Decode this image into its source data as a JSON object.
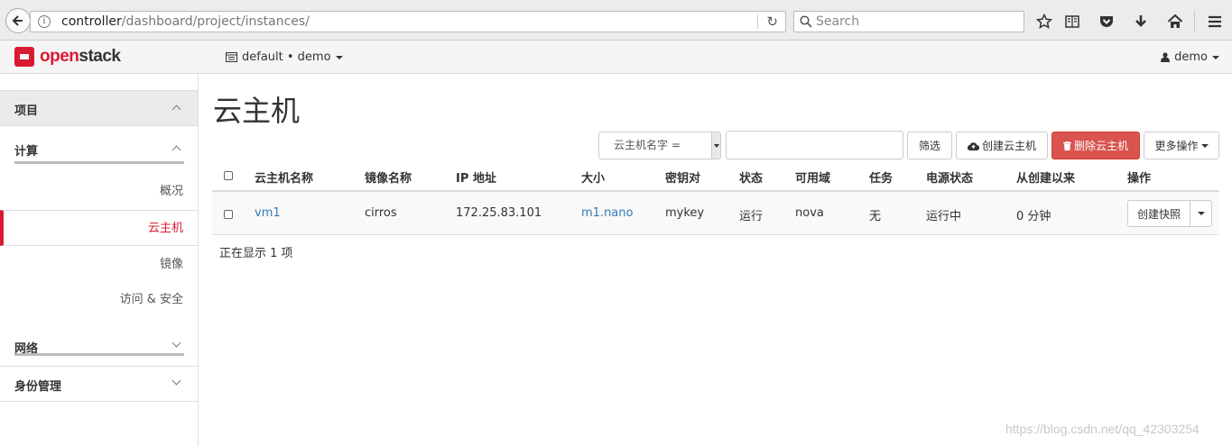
{
  "browser": {
    "url_host": "controller",
    "url_path": "/dashboard/project/instances/",
    "search_placeholder": "Search"
  },
  "topnav": {
    "logo_open": "open",
    "logo_stack": "stack",
    "project_selector": "default • demo",
    "user": "demo"
  },
  "sidebar": {
    "project_label": "项目",
    "compute_label": "计算",
    "items": [
      {
        "label": "概况"
      },
      {
        "label": "云主机",
        "active": true
      },
      {
        "label": "镜像"
      },
      {
        "label": "访问 & 安全"
      }
    ],
    "network_label": "网络",
    "identity_label": "身份管理"
  },
  "main": {
    "title": "云主机",
    "filter_field": "云主机名字 =",
    "filter_value": "",
    "buttons": {
      "filter": "筛选",
      "create": "创建云主机",
      "delete": "删除云主机",
      "more": "更多操作"
    },
    "table": {
      "columns": [
        "云主机名称",
        "镜像名称",
        "IP 地址",
        "大小",
        "密钥对",
        "状态",
        "可用域",
        "任务",
        "电源状态",
        "从创建以来",
        "操作"
      ],
      "rows": [
        {
          "name": "vm1",
          "image": "cirros",
          "ip": "172.25.83.101",
          "size": "m1.nano",
          "keypair": "mykey",
          "status": "运行",
          "zone": "nova",
          "task": "无",
          "power": "运行中",
          "age": "0 分钟",
          "action": "创建快照"
        }
      ]
    },
    "count_text": "正在显示 1 项"
  },
  "watermark": "https://blog.csdn.net/qq_42303254",
  "colors": {
    "accent": "#da1a32",
    "link": "#337ab7",
    "danger": "#d9534f"
  }
}
